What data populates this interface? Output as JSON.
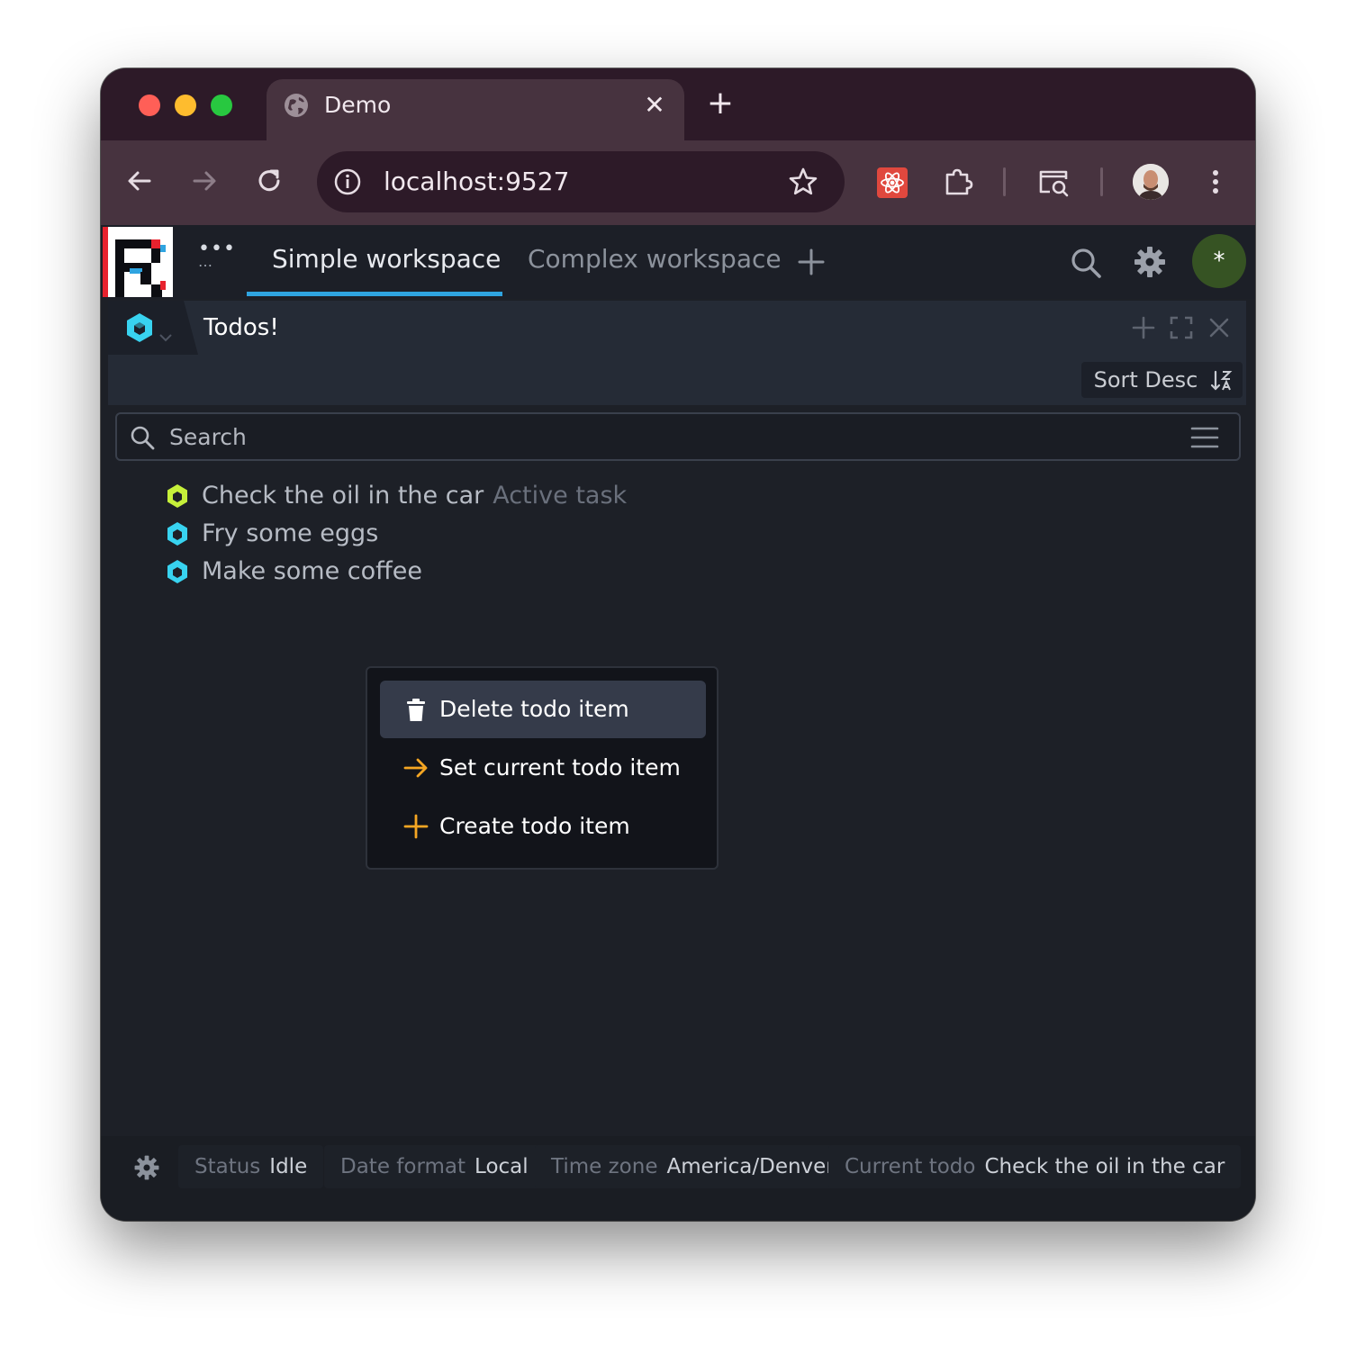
{
  "browser": {
    "tab_title": "Demo",
    "url": "localhost:9527"
  },
  "app": {
    "workspaces": [
      {
        "label": "Simple workspace",
        "active": true
      },
      {
        "label": "Complex workspace",
        "active": false
      }
    ],
    "user_initial": "*"
  },
  "panel": {
    "title": "Todos!",
    "sort_label": "Sort Desc",
    "search_placeholder": "Search"
  },
  "todos": [
    {
      "label": "Check the oil in the car",
      "meta": "Active task",
      "icon_color": "#c6f03a"
    },
    {
      "label": "Fry some eggs",
      "meta": "",
      "icon_color": "#38d3f0"
    },
    {
      "label": "Make some coffee",
      "meta": "",
      "icon_color": "#38d3f0"
    }
  ],
  "context_menu": {
    "items": [
      {
        "label": "Delete todo item",
        "icon": "trash-icon",
        "highlighted": true
      },
      {
        "label": "Set current todo item",
        "icon": "arrow-right-icon",
        "highlighted": false
      },
      {
        "label": "Create todo item",
        "icon": "plus-icon",
        "highlighted": false
      }
    ]
  },
  "status_bar": {
    "status": {
      "key": "Status",
      "value": "Idle"
    },
    "date_format": {
      "key": "Date format",
      "value": "Local"
    },
    "time_zone": {
      "key": "Time zone",
      "value": "America/Denver"
    },
    "current_todo": {
      "key": "Current todo",
      "value": "Check the oil in the car"
    }
  },
  "colors": {
    "accent": "#2fa4e0",
    "menu_icon": "#f5a623",
    "browser_frame": "#2d1a28"
  }
}
